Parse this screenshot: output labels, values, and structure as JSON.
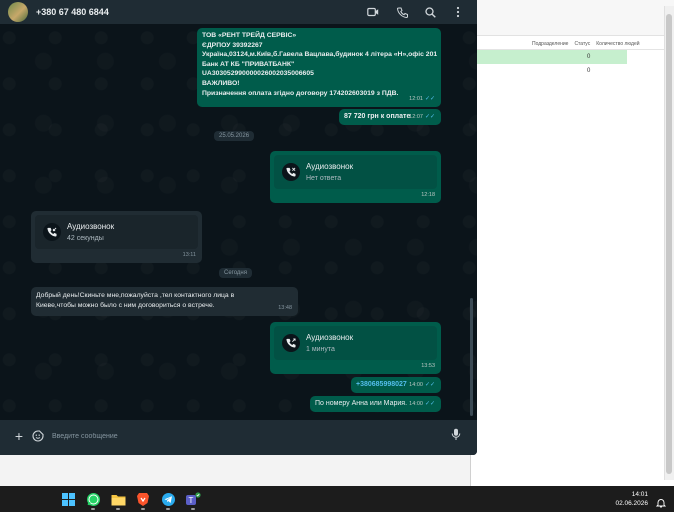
{
  "contact": {
    "name": "+380 67 480 6844"
  },
  "header_icons": [
    "video-call-icon",
    "voice-call-icon",
    "search-icon",
    "menu-icon"
  ],
  "messages": {
    "invoice": {
      "lines": [
        "ТОВ «РЕНТ ТРЕЙД СЕРВІС»",
        "ЄДРПОУ 39392267",
        "Україна,03124,м.Київ,б.Гавела Вацлава,будинок 4 літера «Н»,офіс 201",
        "Банк АТ КБ \"ПРИВАТБАНК\"",
        "UA303052990000026002035006605",
        "ВАЖЛИВО!",
        " Призначення оплата згідно договору 174202603019 з ПДВ."
      ],
      "time": "12:01"
    },
    "payment": {
      "text": "87 720 грн к оплате",
      "time": "12:07"
    },
    "date_chip_1": "25.05.2026",
    "call_1": {
      "title": "Аудиозвонок",
      "subtitle": "Нет ответа",
      "time": "12:18"
    },
    "call_2": {
      "title": "Аудиозвонок",
      "subtitle": "42 секунды",
      "time": "13:11"
    },
    "date_chip_2": "Сегодня",
    "incoming_text": {
      "line1": "Добрый день!Скиньте мне,пожалуйста ,тел контактного лица в",
      "line2": "Киеве,чтобы можно было с ним договориться о встрече.",
      "time": "13:48"
    },
    "call_3": {
      "title": "Аудиозвонок",
      "subtitle": "1 минута",
      "time": "13:53"
    },
    "phone_msg": {
      "text": "+380685998027",
      "time": "14:00"
    },
    "names_msg": {
      "text": "По номеру Анна или Мария.",
      "time": "14:00"
    }
  },
  "composer": {
    "placeholder": "Введите сообщение"
  },
  "background_sheet": {
    "headers": [
      "Подразделение",
      "Статус",
      "Количество людей"
    ],
    "rows": [
      {
        "value": "0",
        "highlight": true
      },
      {
        "value": "0",
        "highlight": false
      }
    ]
  },
  "taskbar": {
    "apps": [
      "windows-start-icon",
      "whatsapp-icon",
      "file-explorer-icon",
      "brave-browser-icon",
      "telegram-icon",
      "teams-icon"
    ],
    "time": "14:01",
    "date": "02.06.2026"
  },
  "colors": {
    "outgoing": "#005c4b",
    "incoming": "#202c33",
    "background": "#0b141a",
    "header": "#1f2c34",
    "link": "#53bdeb"
  }
}
